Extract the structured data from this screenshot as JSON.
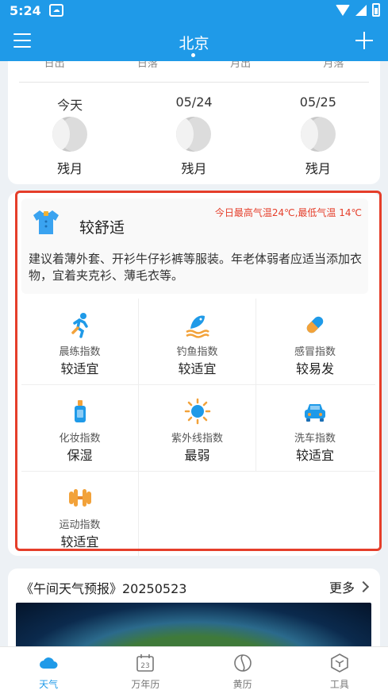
{
  "status_bar": {
    "time": "5:24"
  },
  "header": {
    "title": "北京"
  },
  "moon": {
    "cut_labels": [
      "日出",
      "日落",
      "月出",
      "月落"
    ],
    "days": [
      {
        "date": "今天",
        "phase": "残月"
      },
      {
        "date": "05/24",
        "phase": "残月"
      },
      {
        "date": "05/25",
        "phase": "残月"
      }
    ]
  },
  "dressing": {
    "level": "较舒适",
    "temp_note": "今日最高气温24℃,最低气温 14℃",
    "description": "建议着薄外套、开衫牛仔衫裤等服装。年老体弱者应适当添加衣物，宜着夹克衫、薄毛衣等。"
  },
  "indices": [
    {
      "name": "晨练指数",
      "value": "较适宜",
      "icon": "running-icon"
    },
    {
      "name": "钓鱼指数",
      "value": "较适宜",
      "icon": "fish-icon"
    },
    {
      "name": "感冒指数",
      "value": "较易发",
      "icon": "pill-icon"
    },
    {
      "name": "化妆指数",
      "value": "保湿",
      "icon": "cosmetics-icon"
    },
    {
      "name": "紫外线指数",
      "value": "最弱",
      "icon": "sun-icon"
    },
    {
      "name": "洗车指数",
      "value": "较适宜",
      "icon": "car-icon"
    },
    {
      "name": "运动指数",
      "value": "较适宜",
      "icon": "dumbbell-icon"
    }
  ],
  "news": {
    "title": "《午间天气预报》20250523",
    "more_label": "更多"
  },
  "bottom_nav": [
    {
      "label": "天气",
      "icon": "cloud-icon",
      "active": true
    },
    {
      "label": "万年历",
      "icon": "calendar-icon",
      "active": false
    },
    {
      "label": "黄历",
      "icon": "almanac-icon",
      "active": false
    },
    {
      "label": "工具",
      "icon": "tools-icon",
      "active": false
    }
  ],
  "colors": {
    "primary": "#1f9ae8",
    "highlight": "#e53e2a",
    "temp_note": "#e53e2a"
  }
}
